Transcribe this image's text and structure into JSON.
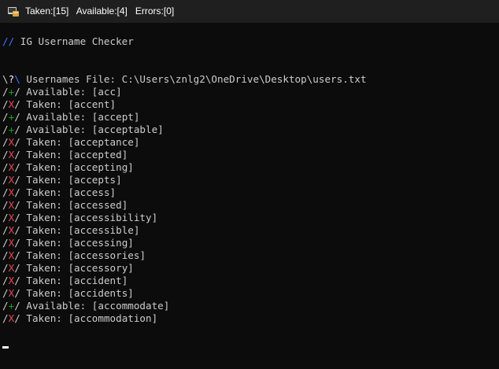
{
  "window": {
    "title": "Taken:[15]   Available:[4]   Errors:[0]",
    "icon": "terminal-app-icon"
  },
  "console": {
    "header_prefix": "//",
    "header_text": " IG Username Checker",
    "file_prefix_slash1": "\\",
    "file_prefix_mark": "?",
    "file_prefix_slash2": "\\",
    "file_text": " Usernames File: C:\\Users\\znlg2\\OneDrive\\Desktop\\users.txt",
    "results": [
      {
        "mark": "+",
        "status": "Available",
        "username": "acc"
      },
      {
        "mark": "X",
        "status": "Taken",
        "username": "accent"
      },
      {
        "mark": "+",
        "status": "Available",
        "username": "accept"
      },
      {
        "mark": "+",
        "status": "Available",
        "username": "acceptable"
      },
      {
        "mark": "X",
        "status": "Taken",
        "username": "acceptance"
      },
      {
        "mark": "X",
        "status": "Taken",
        "username": "accepted"
      },
      {
        "mark": "X",
        "status": "Taken",
        "username": "accepting"
      },
      {
        "mark": "X",
        "status": "Taken",
        "username": "accepts"
      },
      {
        "mark": "X",
        "status": "Taken",
        "username": "access"
      },
      {
        "mark": "X",
        "status": "Taken",
        "username": "accessed"
      },
      {
        "mark": "X",
        "status": "Taken",
        "username": "accessibility"
      },
      {
        "mark": "X",
        "status": "Taken",
        "username": "accessible"
      },
      {
        "mark": "X",
        "status": "Taken",
        "username": "accessing"
      },
      {
        "mark": "X",
        "status": "Taken",
        "username": "accessories"
      },
      {
        "mark": "X",
        "status": "Taken",
        "username": "accessory"
      },
      {
        "mark": "X",
        "status": "Taken",
        "username": "accident"
      },
      {
        "mark": "X",
        "status": "Taken",
        "username": "accidents"
      },
      {
        "mark": "+",
        "status": "Available",
        "username": "accommodate"
      },
      {
        "mark": "X",
        "status": "Taken",
        "username": "accommodation"
      }
    ]
  },
  "colors": {
    "background": "#0c0c0c",
    "titlebar": "#1f1f1f",
    "text": "#cccccc",
    "accent_blue": "#3b78ff",
    "available_green": "#13a10e",
    "taken_red": "#e74856"
  }
}
